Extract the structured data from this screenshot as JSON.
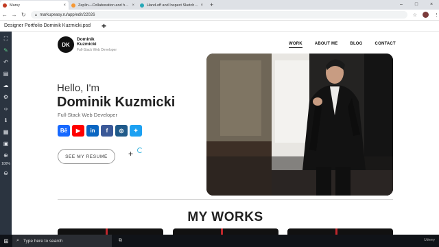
{
  "browser": {
    "tabs": [
      {
        "title": "Marsy",
        "favicon_color": "#c23b22",
        "active": true
      },
      {
        "title": "Zeplin—Collaboration and handoff",
        "favicon_color": "#f69833",
        "active": false
      },
      {
        "title": "Hand-off and Inspect Sketch, Figma",
        "favicon_color": "#27a9b8",
        "active": false
      }
    ],
    "new_tab": "+",
    "window_controls": [
      "–",
      "□",
      "×"
    ],
    "url": "markupeasy.ru/app/edit/22026"
  },
  "app": {
    "filename": "Designer Portfolio Dominik Kuzmicki.psd",
    "add_label": "+",
    "zoom": "100%"
  },
  "site": {
    "logo_initials": "DK",
    "brand_name_line1": "Dominik",
    "brand_name_line2": "Kuzmicki",
    "brand_role": "Full-Stack Web Developer",
    "menu": [
      "WORK",
      "ABOUT ME",
      "BLOG",
      "CONTACT"
    ],
    "hello": "Hello, I'm",
    "name": "Dominik Kuzmicki",
    "role": "Full-Stack Web Developer",
    "socials": [
      {
        "icon": "behance-icon",
        "glyph": "Bē",
        "color": "#1769ff"
      },
      {
        "icon": "youtube-icon",
        "glyph": "▶",
        "color": "#ff0000"
      },
      {
        "icon": "linkedin-icon",
        "glyph": "in",
        "color": "#0a66c2"
      },
      {
        "icon": "facebook-icon",
        "glyph": "f",
        "color": "#3b5998"
      },
      {
        "icon": "instagram-icon",
        "glyph": "◎",
        "color": "#1f5a8a"
      },
      {
        "icon": "twitter-icon",
        "glyph": "✦",
        "color": "#1da1f2"
      }
    ],
    "cv_button": "SEE MY RESUME",
    "section_title": "MY WORKS"
  },
  "taskbar": {
    "search_placeholder": "Type here to search"
  },
  "watermark": "Udemy"
}
